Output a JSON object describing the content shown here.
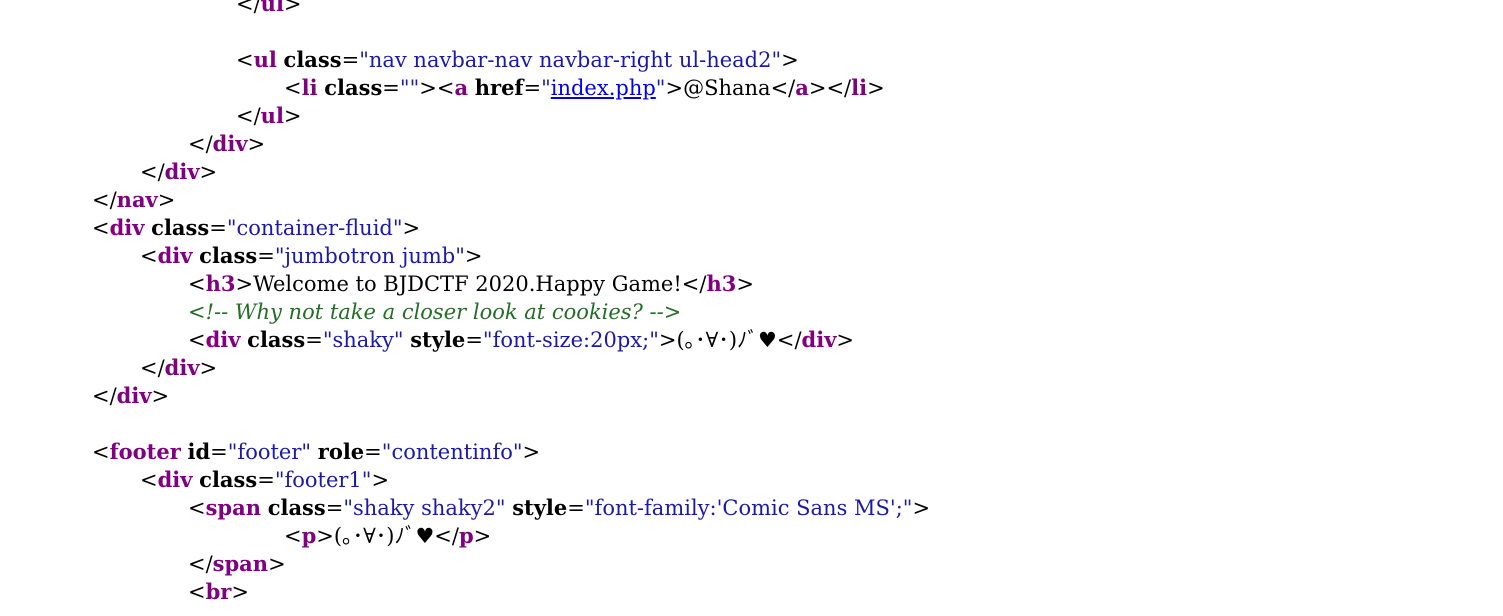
{
  "colors": {
    "background": "#ffffff",
    "tag": "#800080",
    "attribute": "#000000",
    "value": "#1a1aa6",
    "link": "#0000ee",
    "comment": "#236e25",
    "text": "#000000"
  },
  "lines": [
    {
      "indent": 3,
      "tokens": [
        {
          "t": "bracket",
          "v": "</"
        },
        {
          "t": "tag",
          "v": "ul"
        },
        {
          "t": "bracket",
          "v": ">"
        }
      ]
    },
    {
      "indent": 0,
      "tokens": []
    },
    {
      "indent": 3,
      "tokens": [
        {
          "t": "bracket",
          "v": "<"
        },
        {
          "t": "tag",
          "v": "ul"
        },
        {
          "t": "text",
          "v": " "
        },
        {
          "t": "attr",
          "v": "class"
        },
        {
          "t": "text",
          "v": "="
        },
        {
          "t": "value",
          "v": "\"nav navbar-nav navbar-right ul-head2\""
        },
        {
          "t": "bracket",
          "v": ">"
        }
      ]
    },
    {
      "indent": 4,
      "tokens": [
        {
          "t": "bracket",
          "v": "<"
        },
        {
          "t": "tag",
          "v": "li"
        },
        {
          "t": "text",
          "v": " "
        },
        {
          "t": "attr",
          "v": "class"
        },
        {
          "t": "text",
          "v": "="
        },
        {
          "t": "value",
          "v": "\"\""
        },
        {
          "t": "bracket",
          "v": "><"
        },
        {
          "t": "tag",
          "v": "a"
        },
        {
          "t": "text",
          "v": " "
        },
        {
          "t": "attr",
          "v": "href"
        },
        {
          "t": "text",
          "v": "="
        },
        {
          "t": "value",
          "v": "\""
        },
        {
          "t": "link",
          "v": "index.php"
        },
        {
          "t": "value",
          "v": "\""
        },
        {
          "t": "bracket",
          "v": ">"
        },
        {
          "t": "text",
          "v": "@Shana"
        },
        {
          "t": "bracket",
          "v": "</"
        },
        {
          "t": "tag",
          "v": "a"
        },
        {
          "t": "bracket",
          "v": "></"
        },
        {
          "t": "tag",
          "v": "li"
        },
        {
          "t": "bracket",
          "v": ">"
        }
      ]
    },
    {
      "indent": 3,
      "tokens": [
        {
          "t": "bracket",
          "v": "</"
        },
        {
          "t": "tag",
          "v": "ul"
        },
        {
          "t": "bracket",
          "v": ">"
        }
      ]
    },
    {
      "indent": 2,
      "tokens": [
        {
          "t": "bracket",
          "v": "</"
        },
        {
          "t": "tag",
          "v": "div"
        },
        {
          "t": "bracket",
          "v": ">"
        }
      ]
    },
    {
      "indent": 1,
      "tokens": [
        {
          "t": "bracket",
          "v": "</"
        },
        {
          "t": "tag",
          "v": "div"
        },
        {
          "t": "bracket",
          "v": ">"
        }
      ]
    },
    {
      "indent": 0,
      "tokens": [
        {
          "t": "bracket",
          "v": "</"
        },
        {
          "t": "tag",
          "v": "nav"
        },
        {
          "t": "bracket",
          "v": ">"
        }
      ]
    },
    {
      "indent": 0,
      "tokens": [
        {
          "t": "bracket",
          "v": "<"
        },
        {
          "t": "tag",
          "v": "div"
        },
        {
          "t": "text",
          "v": " "
        },
        {
          "t": "attr",
          "v": "class"
        },
        {
          "t": "text",
          "v": "="
        },
        {
          "t": "value",
          "v": "\"container-fluid\""
        },
        {
          "t": "bracket",
          "v": ">"
        }
      ]
    },
    {
      "indent": 1,
      "tokens": [
        {
          "t": "bracket",
          "v": "<"
        },
        {
          "t": "tag",
          "v": "div"
        },
        {
          "t": "text",
          "v": " "
        },
        {
          "t": "attr",
          "v": "class"
        },
        {
          "t": "text",
          "v": "="
        },
        {
          "t": "value",
          "v": "\"jumbotron jumb\""
        },
        {
          "t": "bracket",
          "v": ">"
        }
      ]
    },
    {
      "indent": 2,
      "tokens": [
        {
          "t": "bracket",
          "v": "<"
        },
        {
          "t": "tag",
          "v": "h3"
        },
        {
          "t": "bracket",
          "v": ">"
        },
        {
          "t": "text",
          "v": "Welcome to BJDCTF 2020.Happy Game!"
        },
        {
          "t": "bracket",
          "v": "</"
        },
        {
          "t": "tag",
          "v": "h3"
        },
        {
          "t": "bracket",
          "v": ">"
        }
      ]
    },
    {
      "indent": 2,
      "tokens": [
        {
          "t": "comment",
          "v": "<!-- Why not take a closer look at cookies? -->"
        }
      ]
    },
    {
      "indent": 2,
      "tokens": [
        {
          "t": "bracket",
          "v": "<"
        },
        {
          "t": "tag",
          "v": "div"
        },
        {
          "t": "text",
          "v": " "
        },
        {
          "t": "attr",
          "v": "class"
        },
        {
          "t": "text",
          "v": "="
        },
        {
          "t": "value",
          "v": "\"shaky\""
        },
        {
          "t": "text",
          "v": " "
        },
        {
          "t": "attr",
          "v": "style"
        },
        {
          "t": "text",
          "v": "="
        },
        {
          "t": "value",
          "v": "\"font-size:20px;\""
        },
        {
          "t": "bracket",
          "v": ">"
        },
        {
          "t": "text",
          "v": "(｡･∀･)ﾉﾞ♥"
        },
        {
          "t": "bracket",
          "v": "</"
        },
        {
          "t": "tag",
          "v": "div"
        },
        {
          "t": "bracket",
          "v": ">"
        }
      ]
    },
    {
      "indent": 1,
      "tokens": [
        {
          "t": "bracket",
          "v": "</"
        },
        {
          "t": "tag",
          "v": "div"
        },
        {
          "t": "bracket",
          "v": ">"
        }
      ]
    },
    {
      "indent": 0,
      "tokens": [
        {
          "t": "bracket",
          "v": "</"
        },
        {
          "t": "tag",
          "v": "div"
        },
        {
          "t": "bracket",
          "v": ">"
        }
      ]
    },
    {
      "indent": 0,
      "tokens": []
    },
    {
      "indent": 0,
      "tokens": [
        {
          "t": "bracket",
          "v": "<"
        },
        {
          "t": "tag",
          "v": "footer"
        },
        {
          "t": "text",
          "v": " "
        },
        {
          "t": "attr",
          "v": "id"
        },
        {
          "t": "text",
          "v": "="
        },
        {
          "t": "value",
          "v": "\"footer\""
        },
        {
          "t": "text",
          "v": " "
        },
        {
          "t": "attr",
          "v": "role"
        },
        {
          "t": "text",
          "v": "="
        },
        {
          "t": "value",
          "v": "\"contentinfo\""
        },
        {
          "t": "bracket",
          "v": ">"
        }
      ]
    },
    {
      "indent": 1,
      "tokens": [
        {
          "t": "bracket",
          "v": "<"
        },
        {
          "t": "tag",
          "v": "div"
        },
        {
          "t": "text",
          "v": " "
        },
        {
          "t": "attr",
          "v": "class"
        },
        {
          "t": "text",
          "v": "="
        },
        {
          "t": "value",
          "v": "\"footer1\""
        },
        {
          "t": "bracket",
          "v": ">"
        }
      ]
    },
    {
      "indent": 2,
      "tokens": [
        {
          "t": "bracket",
          "v": "<"
        },
        {
          "t": "tag",
          "v": "span"
        },
        {
          "t": "text",
          "v": " "
        },
        {
          "t": "attr",
          "v": "class"
        },
        {
          "t": "text",
          "v": "="
        },
        {
          "t": "value",
          "v": "\"shaky shaky2\""
        },
        {
          "t": "text",
          "v": " "
        },
        {
          "t": "attr",
          "v": "style"
        },
        {
          "t": "text",
          "v": "="
        },
        {
          "t": "value",
          "v": "\"font-family:'Comic Sans MS';\""
        },
        {
          "t": "bracket",
          "v": ">"
        }
      ]
    },
    {
      "indent": 4,
      "tokens": [
        {
          "t": "bracket",
          "v": "<"
        },
        {
          "t": "tag",
          "v": "p"
        },
        {
          "t": "bracket",
          "v": ">"
        },
        {
          "t": "text",
          "v": "(｡･∀･)ﾉﾞ♥"
        },
        {
          "t": "bracket",
          "v": "</"
        },
        {
          "t": "tag",
          "v": "p"
        },
        {
          "t": "bracket",
          "v": ">"
        }
      ]
    },
    {
      "indent": 2,
      "tokens": [
        {
          "t": "bracket",
          "v": "</"
        },
        {
          "t": "tag",
          "v": "span"
        },
        {
          "t": "bracket",
          "v": ">"
        }
      ]
    },
    {
      "indent": 2,
      "tokens": [
        {
          "t": "bracket",
          "v": "<"
        },
        {
          "t": "tag",
          "v": "br"
        },
        {
          "t": "bracket",
          "v": ">"
        }
      ]
    }
  ]
}
